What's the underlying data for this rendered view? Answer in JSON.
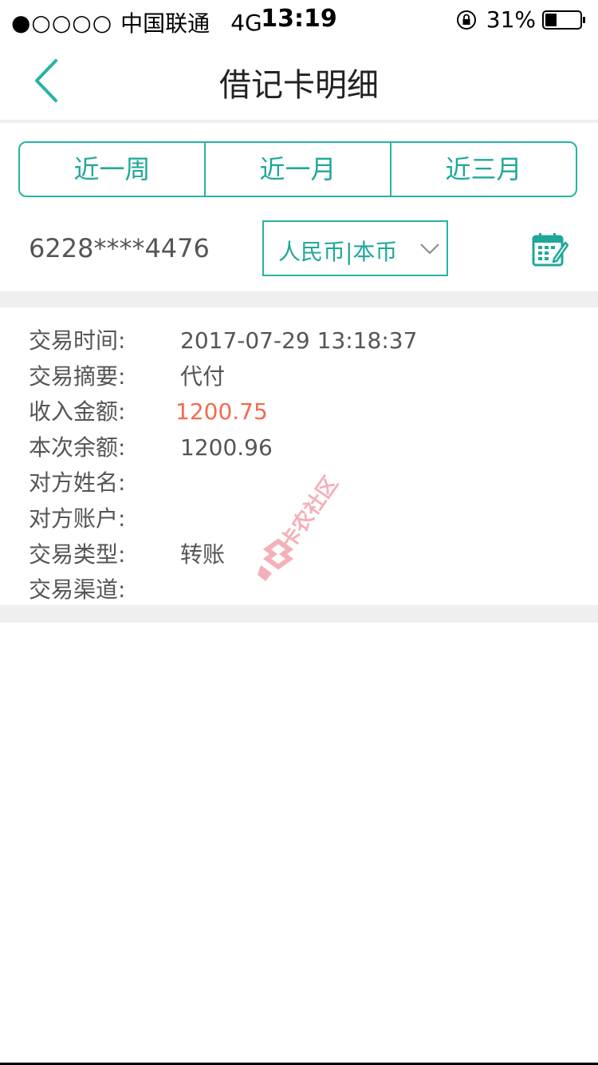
{
  "status_bar": {
    "signal": "●○○○○",
    "carrier": "中国联通",
    "network": "4G",
    "time": "13:19",
    "battery": "31%"
  },
  "nav": {
    "title": "借记卡明细",
    "back_icon": "chevron-left-icon"
  },
  "tabs": [
    {
      "label": "近一周"
    },
    {
      "label": "近一月"
    },
    {
      "label": "近三月"
    }
  ],
  "filter": {
    "card_number": "6228****4476",
    "currency": "人民币|本币",
    "calendar_icon": "calendar-edit-icon"
  },
  "transaction": [
    {
      "label": "交易时间:",
      "value": "2017-07-29 13:18:37"
    },
    {
      "label": "交易摘要:",
      "value": "代付"
    },
    {
      "label": "收入金额:",
      "value": "1200.75"
    },
    {
      "label": "本次余额:",
      "value": "1200.96"
    },
    {
      "label": "对方姓名:",
      "value": ""
    },
    {
      "label": "对方账户:",
      "value": ""
    },
    {
      "label": "交易类型:",
      "value": "转账"
    },
    {
      "label": "交易渠道:",
      "value": ""
    }
  ],
  "watermark": {
    "text": "卡农社区"
  },
  "colors": {
    "accent": "#26b3a4",
    "income": "#f26b4f",
    "divider": "#efefef"
  }
}
